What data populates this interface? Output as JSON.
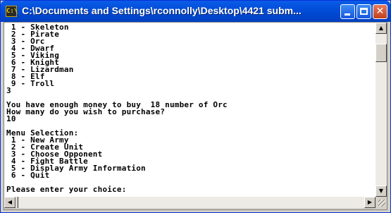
{
  "window": {
    "title": "C:\\Documents and Settings\\rconnolly\\Desktop\\4421 subm...",
    "icon": "console-app-icon",
    "icon_glyph": "C:\\",
    "controls": {
      "minimize_icon": "minimize-icon",
      "maximize_icon": "maximize-icon",
      "close_icon": "close-icon",
      "close_glyph": "✕"
    }
  },
  "console": {
    "lines": [
      " 1 - Skeleton",
      " 2 - Pirate",
      " 3 - Orc",
      " 4 - Dwarf",
      " 5 - Viking",
      " 6 - Knight",
      " 7 - Lizardman",
      " 8 - Elf",
      " 9 - Troll",
      "3",
      "",
      "You have enough money to buy  18 number of Orc",
      "How many do you wish to purchase?",
      "10",
      "",
      "Menu Selection:",
      " 1 - New Army",
      " 2 - Create Unit",
      " 3 - Choose Opponent",
      " 4 - Fight Battle",
      " 5 - Display Army Information",
      " 6 - Quit",
      "",
      "Please enter your choice:"
    ]
  },
  "scrollbars": {
    "up_glyph": "▲",
    "down_glyph": "▼",
    "left_glyph": "◀",
    "right_glyph": "▶"
  },
  "colors": {
    "title_bar": "#0054e3",
    "console_bg": "#ffffff",
    "console_text": "#000000",
    "close_button": "#d9542f"
  }
}
